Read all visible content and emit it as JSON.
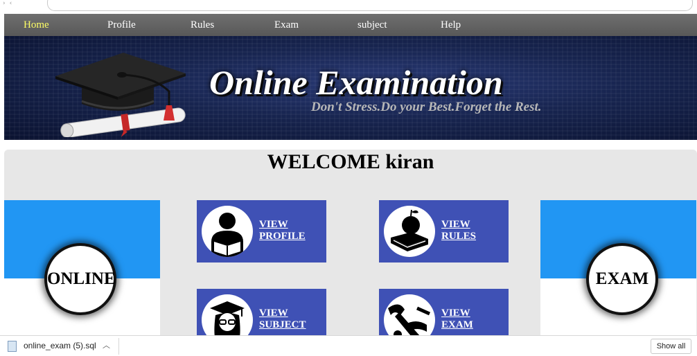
{
  "nav": {
    "items": [
      {
        "label": "Home",
        "active": true
      },
      {
        "label": "Profile"
      },
      {
        "label": "Rules"
      },
      {
        "label": "Exam"
      },
      {
        "label": "subject"
      },
      {
        "label": "Help"
      }
    ]
  },
  "banner": {
    "title": "Online Examination",
    "tagline": "Don't Stress.Do your Best.Forget the Rest.",
    "graphic_icon": "graduation-cap-diploma-icon"
  },
  "main": {
    "welcome": "WELCOME kiran",
    "left_badge": "ONLINE",
    "right_badge": "EXAM",
    "tiles": [
      {
        "line1": "VIEW",
        "line2": "PROFILE",
        "icon": "reader-person-icon"
      },
      {
        "line1": "VIEW",
        "line2": "RULES",
        "icon": "apple-on-books-icon"
      },
      {
        "line1": "VIEW",
        "line2": "SUBJECT",
        "icon": "graduate-student-icon"
      },
      {
        "line1": "VIEW",
        "line2": "EXAM",
        "icon": "exam-icon"
      }
    ]
  },
  "downloads": {
    "file_name": "online_exam (5).sql",
    "show_all_label": "Show all"
  },
  "colors": {
    "nav_bg": "#636363",
    "nav_active": "#ffff66",
    "tile_bg": "#3f51b5",
    "side_blue": "#2196f3",
    "panel_bg": "#e7e7e7"
  }
}
